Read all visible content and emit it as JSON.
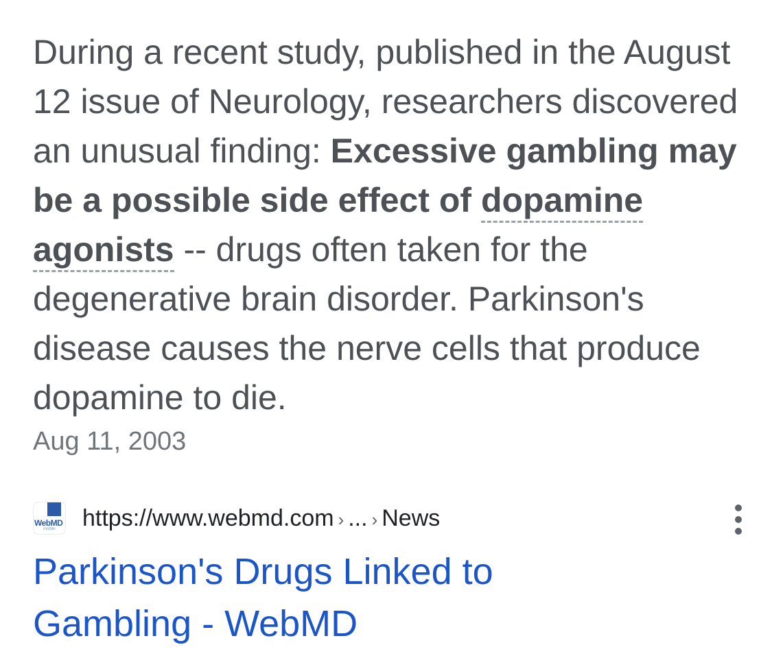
{
  "snippet": {
    "text_before": "During a recent study, published in the August 12 issue of Neurology, researchers discovered an unusual finding: ",
    "bold_before_link": "Excessive gambling may be a possible side effect of ",
    "bold_link": "dopamine agonists",
    "text_after": " -- drugs often taken for the degenerative brain disorder. Parkinson's disease causes the nerve cells that produce dopamine to die."
  },
  "date": "Aug 11, 2003",
  "result": {
    "favicon_text": "WebMD",
    "favicon_subtext": "mobile",
    "url_base": "https://www.webmd.com",
    "breadcrumb_sep": "›",
    "breadcrumb_ellipsis": "...",
    "breadcrumb_last": "News",
    "title_line1": "Parkinson's Drugs Linked to",
    "title_line2": "Gambling - WebMD"
  },
  "colors": {
    "snippet_text": "#4d5156",
    "date_text": "#70757a",
    "link_blue": "#1a56c9",
    "favicon_brand": "#2a5aa8"
  },
  "icons": {
    "more_options": "three-dot-vertical-icon"
  }
}
